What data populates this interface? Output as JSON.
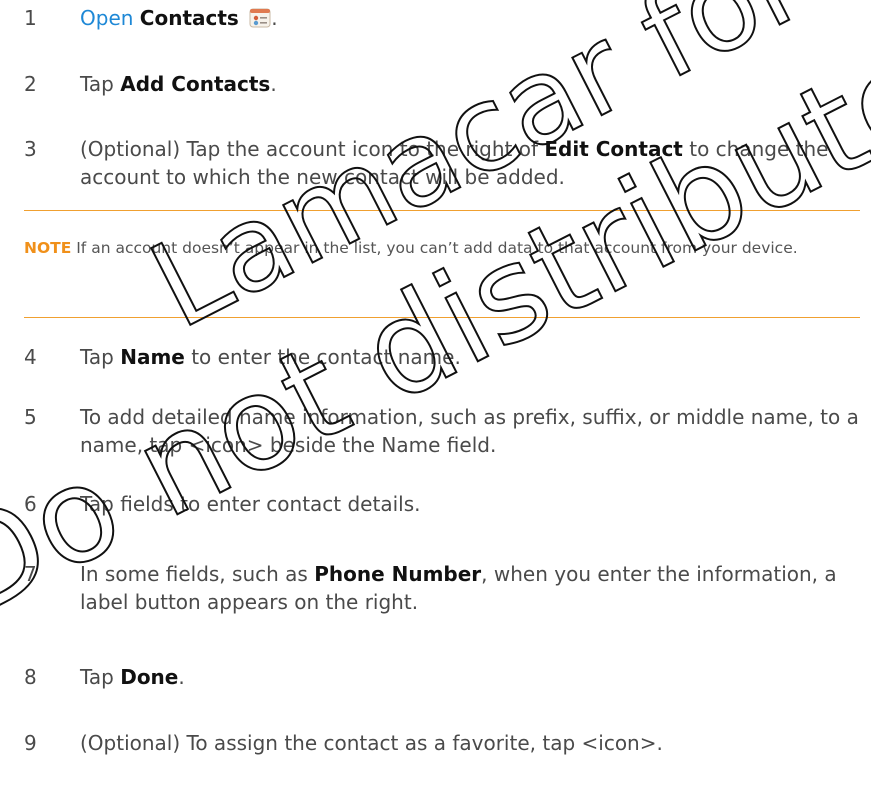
{
  "steps": [
    {
      "num": "1",
      "link": "Open",
      "bold": "Contacts",
      "after": "."
    },
    {
      "num": "2",
      "before": "Tap ",
      "bold": "Add Contacts",
      "after": "."
    },
    {
      "num": "3",
      "before": "(Optional) Tap the account icon to the right of ",
      "bold": "Edit Contact",
      "after": " to change the account to which the new contact will be added."
    },
    {
      "num": "4",
      "before": "Tap ",
      "bold": "Name",
      "after": " to enter the contact name."
    },
    {
      "num": "5",
      "text": "To add detailed name information, such as prefix, suffix, or middle name, to a name, tap <icon> beside the Name field."
    },
    {
      "num": "6",
      "text": "Tap fields to enter contact details."
    },
    {
      "num": "7",
      "before": "In some fields, such as ",
      "bold": "Phone Number",
      "after": ", when you enter the information, a label button appears on the right."
    },
    {
      "num": "8",
      "before": "Tap ",
      "bold": "Done",
      "after": "."
    },
    {
      "num": "9",
      "text": "(Optional) To assign the contact as a favorite, tap <icon>."
    }
  ],
  "note": {
    "label": "NOTE",
    "text": " If an account doesn’t appear in the list, you can’t add data to that account from your device."
  },
  "icons": {
    "contacts_app": "contacts-app-icon"
  },
  "watermark": {
    "line1": "Lamacar for Lab En",
    "line2": "Do not distribute."
  },
  "colors": {
    "link": "#1e88d6",
    "note_accent": "#f0a030",
    "text": "#4a4a4a",
    "watermark": "#111111"
  }
}
